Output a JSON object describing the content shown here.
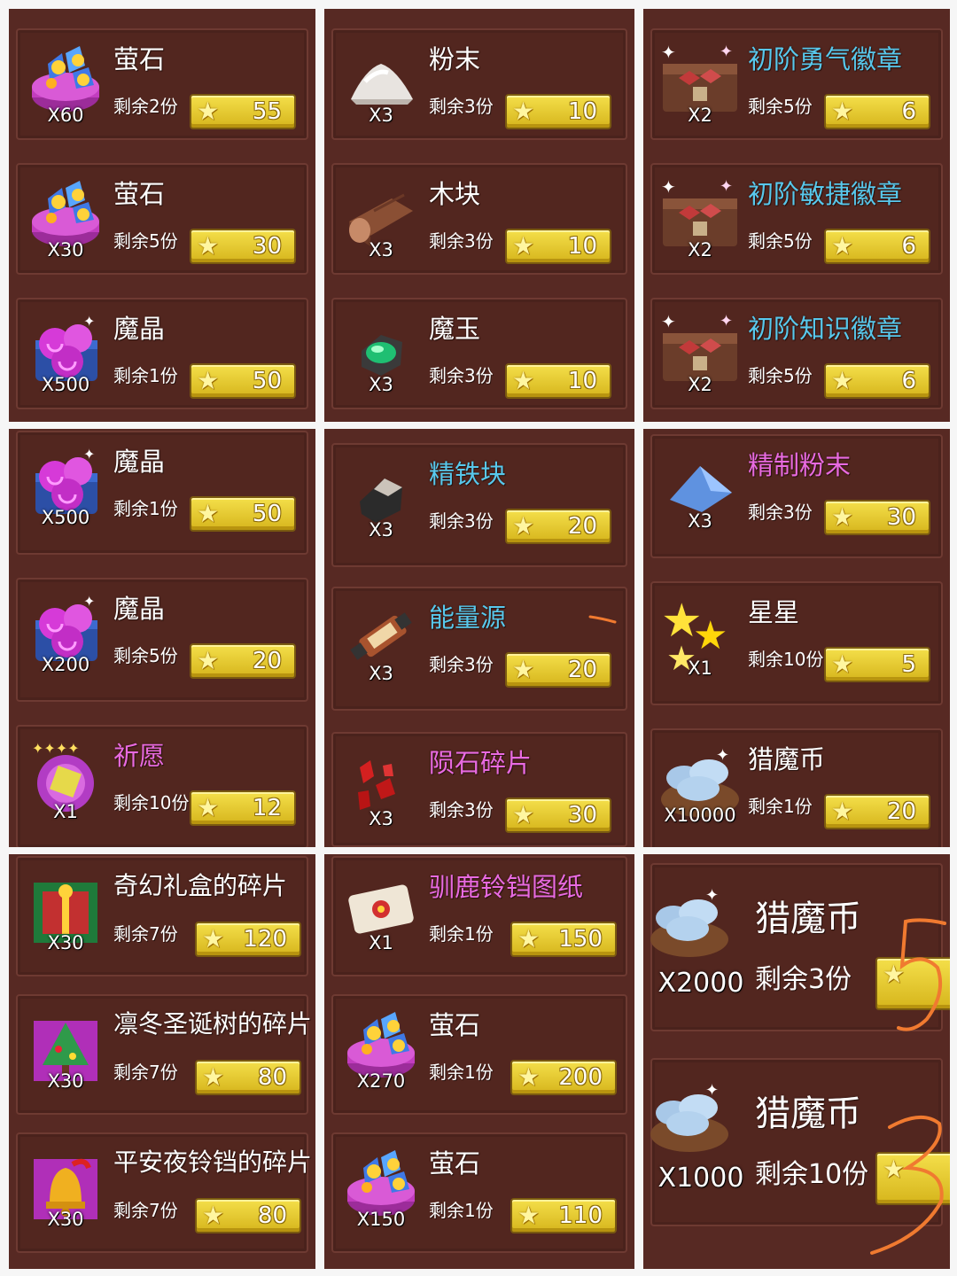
{
  "colors": {
    "panel_bg": "#572923",
    "card_bg": "#52261f",
    "price_button": "#f0d53a",
    "cyan_name": "#58c8ec",
    "pink_name": "#e86ae0",
    "annotation": "#f07a30"
  },
  "panels": [
    {
      "id": "p1",
      "items": [
        {
          "name": "萤石",
          "qty": "X60",
          "remain": "剩余2份",
          "price": "55",
          "icon": "fluorite-icon",
          "color": "white"
        },
        {
          "name": "萤石",
          "qty": "X30",
          "remain": "剩余5份",
          "price": "30",
          "icon": "fluorite-icon",
          "color": "white"
        },
        {
          "name": "魔晶",
          "qty": "X500",
          "remain": "剩余1份",
          "price": "50",
          "icon": "magic-crystal-icon",
          "color": "white"
        }
      ]
    },
    {
      "id": "p2",
      "items": [
        {
          "name": "粉末",
          "qty": "X3",
          "remain": "剩余3份",
          "price": "10",
          "icon": "powder-icon",
          "color": "white"
        },
        {
          "name": "木块",
          "qty": "X3",
          "remain": "剩余3份",
          "price": "10",
          "icon": "wood-icon",
          "color": "white"
        },
        {
          "name": "魔玉",
          "qty": "X3",
          "remain": "剩余3份",
          "price": "10",
          "icon": "magic-jade-icon",
          "color": "white"
        }
      ]
    },
    {
      "id": "p3",
      "items": [
        {
          "name": "初阶勇气徽章",
          "qty": "X2",
          "remain": "剩余5份",
          "price": "6",
          "icon": "badge-chest-icon",
          "color": "cyan"
        },
        {
          "name": "初阶敏捷徽章",
          "qty": "X2",
          "remain": "剩余5份",
          "price": "6",
          "icon": "badge-chest-icon",
          "color": "cyan"
        },
        {
          "name": "初阶知识徽章",
          "qty": "X2",
          "remain": "剩余5份",
          "price": "6",
          "icon": "badge-chest-icon",
          "color": "cyan"
        }
      ]
    },
    {
      "id": "p4",
      "items": [
        {
          "name": "魔晶",
          "qty": "X500",
          "remain": "剩余1份",
          "price": "50",
          "icon": "magic-crystal-icon",
          "color": "white"
        },
        {
          "name": "魔晶",
          "qty": "X200",
          "remain": "剩余5份",
          "price": "20",
          "icon": "magic-crystal-icon",
          "color": "white"
        },
        {
          "name": "祈愿",
          "qty": "X1",
          "remain": "剩余10份",
          "price": "12",
          "icon": "wish-icon",
          "color": "pink"
        }
      ]
    },
    {
      "id": "p5",
      "items": [
        {
          "name": "精铁块",
          "qty": "X3",
          "remain": "剩余3份",
          "price": "20",
          "icon": "iron-ingot-icon",
          "color": "cyan"
        },
        {
          "name": "能量源",
          "qty": "X3",
          "remain": "剩余3份",
          "price": "20",
          "icon": "energy-source-icon",
          "color": "cyan"
        },
        {
          "name": "陨石碎片",
          "qty": "X3",
          "remain": "剩余3份",
          "price": "30",
          "icon": "meteorite-icon",
          "color": "pink"
        }
      ]
    },
    {
      "id": "p6",
      "items": [
        {
          "name": "精制粉末",
          "qty": "X3",
          "remain": "剩余3份",
          "price": "30",
          "icon": "refined-powder-icon",
          "color": "pink"
        },
        {
          "name": "星星",
          "qty": "X1",
          "remain": "剩余10份",
          "price": "5",
          "icon": "stars-icon",
          "color": "white"
        },
        {
          "name": "猎魔币",
          "qty": "X10000",
          "remain": "剩余1份",
          "price": "20",
          "icon": "demon-coin-icon",
          "color": "white"
        }
      ]
    },
    {
      "id": "p7",
      "items": [
        {
          "name": "奇幻礼盒的碎片",
          "qty": "X30",
          "remain": "剩余7份",
          "price": "120",
          "icon": "gift-box-fragment-icon",
          "color": "white"
        },
        {
          "name": "凛冬圣诞树的碎片",
          "qty": "X30",
          "remain": "剩余7份",
          "price": "80",
          "icon": "christmas-tree-fragment-icon",
          "color": "white"
        },
        {
          "name": "平安夜铃铛的碎片",
          "qty": "X30",
          "remain": "剩余7份",
          "price": "80",
          "icon": "bell-fragment-icon",
          "color": "white"
        }
      ]
    },
    {
      "id": "p8",
      "items": [
        {
          "name": "驯鹿铃铛图纸",
          "qty": "X1",
          "remain": "剩余1份",
          "price": "150",
          "icon": "blueprint-icon",
          "color": "pink"
        },
        {
          "name": "萤石",
          "qty": "X270",
          "remain": "剩余1份",
          "price": "200",
          "icon": "fluorite-icon",
          "color": "white"
        },
        {
          "name": "萤石",
          "qty": "X150",
          "remain": "剩余1份",
          "price": "110",
          "icon": "fluorite-icon",
          "color": "white"
        }
      ]
    },
    {
      "id": "p9",
      "items": [
        {
          "name": "猎魔币",
          "qty": "X2000",
          "remain": "剩余3份",
          "price": "",
          "icon": "demon-coin-icon",
          "color": "white"
        },
        {
          "name": "猎魔币",
          "qty": "X1000",
          "remain": "剩余10份",
          "price": "",
          "icon": "demon-coin-icon",
          "color": "white"
        }
      ]
    }
  ]
}
